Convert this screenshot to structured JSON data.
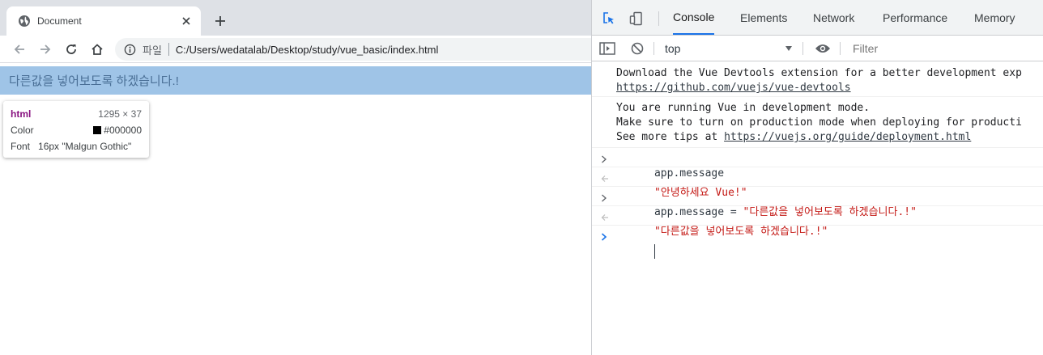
{
  "browser": {
    "tab_title": "Document",
    "new_tab_symbol": "+",
    "scheme_label": "파일",
    "url": "C:/Users/wedatalab/Desktop/study/vue_basic/index.html",
    "icons": [
      "globe-icon",
      "close-icon",
      "plus-icon",
      "back-arrow-icon",
      "forward-arrow-icon",
      "reload-icon",
      "home-icon",
      "info-icon"
    ]
  },
  "page": {
    "heading_text": "다른값을 넣어보도록 하겠습니다.!",
    "tooltip": {
      "tag": "html",
      "dims": "1295 × 37",
      "color_label": "Color",
      "color_value": "#000000",
      "font_label": "Font",
      "font_value": "16px \"Malgun Gothic\""
    }
  },
  "devtools": {
    "tabs": [
      {
        "label": "Console",
        "active": true
      },
      {
        "label": "Elements",
        "active": false
      },
      {
        "label": "Network",
        "active": false
      },
      {
        "label": "Performance",
        "active": false
      },
      {
        "label": "Memory",
        "active": false
      }
    ],
    "context": "top",
    "filter_placeholder": "Filter",
    "accent": "#1a73e8",
    "messages": {
      "m1_line1": "Download the Vue Devtools extension for a better development exp",
      "m1_link": "https://github.com/vuejs/vue-devtools",
      "m2_line1": "You are running Vue in development mode.",
      "m2_line2": "Make sure to turn on production mode when deploying for producti",
      "m2_line3_prefix": "See more tips at ",
      "m2_link": "https://vuejs.org/guide/deployment.html",
      "in1": "app.message",
      "out1": "\"안녕하세요 Vue!\"",
      "in2_cmd": "app.message",
      "in2_op": " = ",
      "in2_str": "\"다른값을 넣어보도록 하겠습니다.!\"",
      "out2": "\"다른값을 넣어보도록 하겠습니다.!\""
    }
  }
}
